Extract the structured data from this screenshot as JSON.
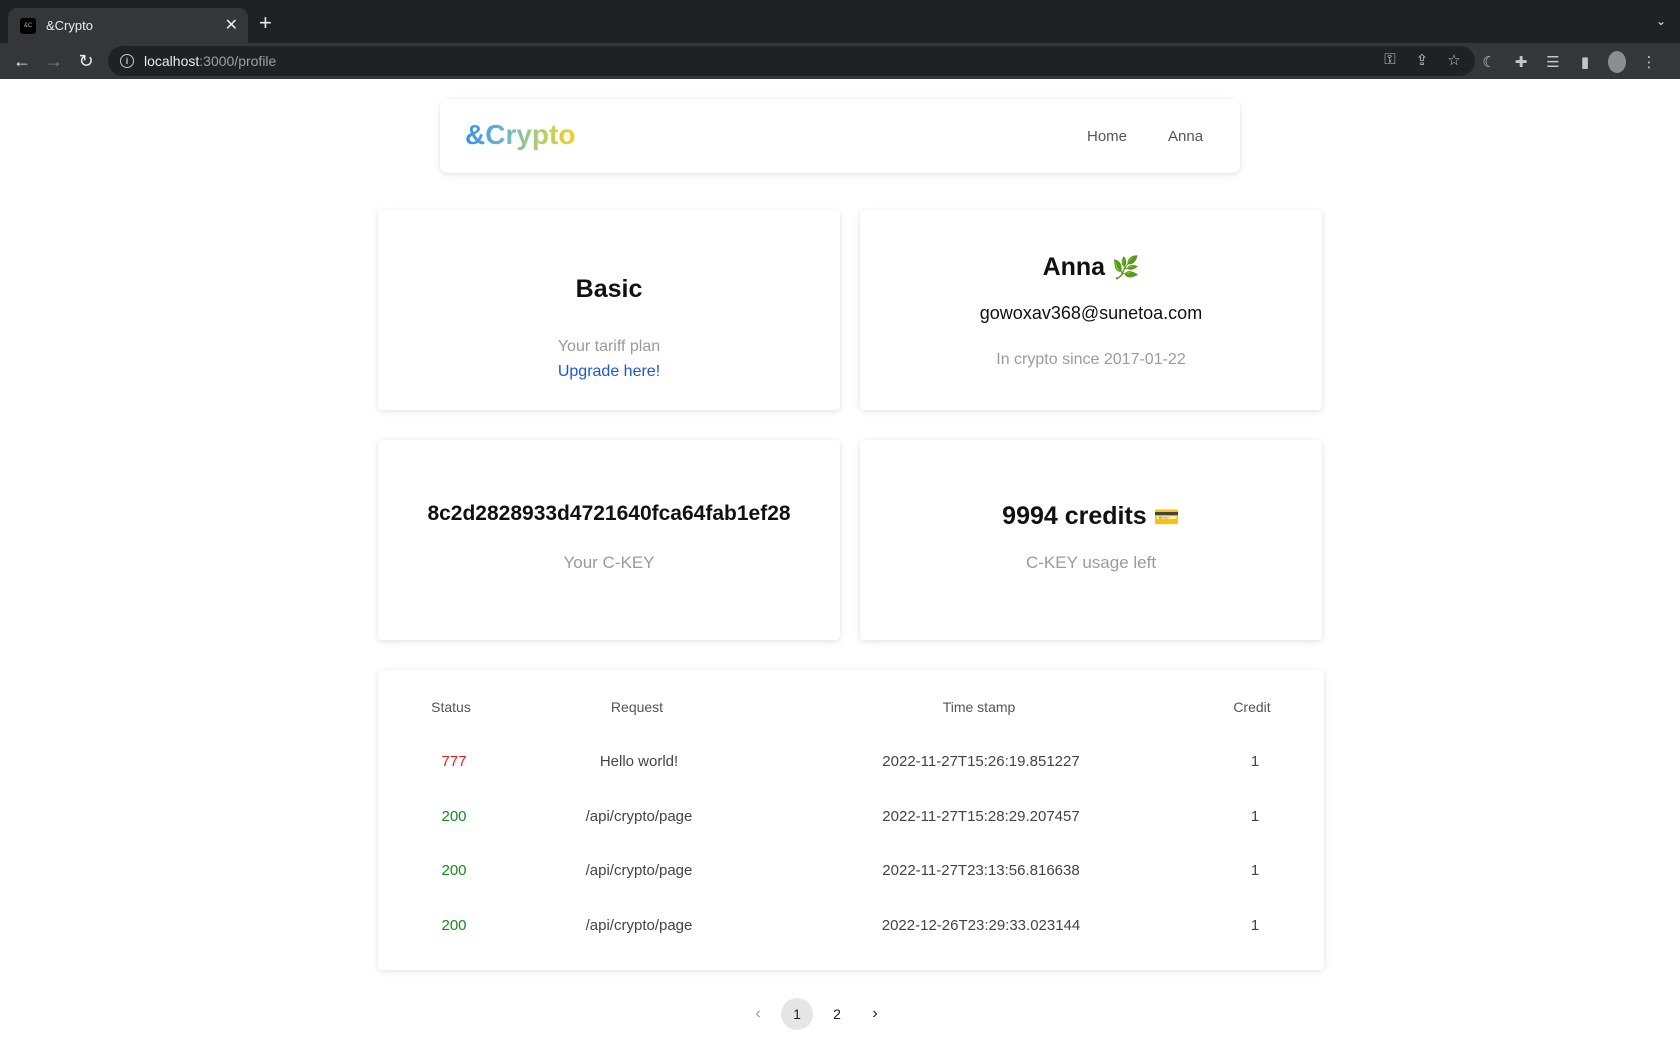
{
  "browser": {
    "tab_title": "&Crypto",
    "favicon_text": "&C",
    "url_host": "localhost",
    "url_path": ":3000/profile"
  },
  "header": {
    "logo": "&Crypto",
    "nav": [
      {
        "label": "Home"
      },
      {
        "label": "Anna"
      }
    ]
  },
  "plan_card": {
    "title": "Basic",
    "subtitle": "Your tariff plan",
    "link": "Upgrade here!"
  },
  "user_card": {
    "name": "Anna",
    "emoji": "🌿",
    "email": "gowoxav368@sunetoa.com",
    "since": "In crypto since 2017-01-22"
  },
  "key_card": {
    "key": "8c2d2828933d4721640fca64fab1ef28",
    "label": "Your C-KEY"
  },
  "credits_card": {
    "title": "9994 credits",
    "emoji": "💳",
    "label": "C-KEY usage left"
  },
  "table": {
    "headers": [
      "Status",
      "Request",
      "Time stamp",
      "Credit"
    ],
    "rows": [
      {
        "status": "777",
        "request": "Hello world!",
        "timestamp": "2022-11-27T15:26:19.851227",
        "credit": "1"
      },
      {
        "status": "200",
        "request": "/api/crypto/page",
        "timestamp": "2022-11-27T15:28:29.207457",
        "credit": "1"
      },
      {
        "status": "200",
        "request": "/api/crypto/page",
        "timestamp": "2022-11-27T23:13:56.816638",
        "credit": "1"
      },
      {
        "status": "200",
        "request": "/api/crypto/page",
        "timestamp": "2022-12-26T23:29:33.023144",
        "credit": "1"
      }
    ],
    "status_colors": {
      "777": "#e02020",
      "200": "#128a1a"
    }
  },
  "pagination": {
    "prev": "‹",
    "pages": [
      "1",
      "2"
    ],
    "current": "1",
    "next": "›"
  }
}
